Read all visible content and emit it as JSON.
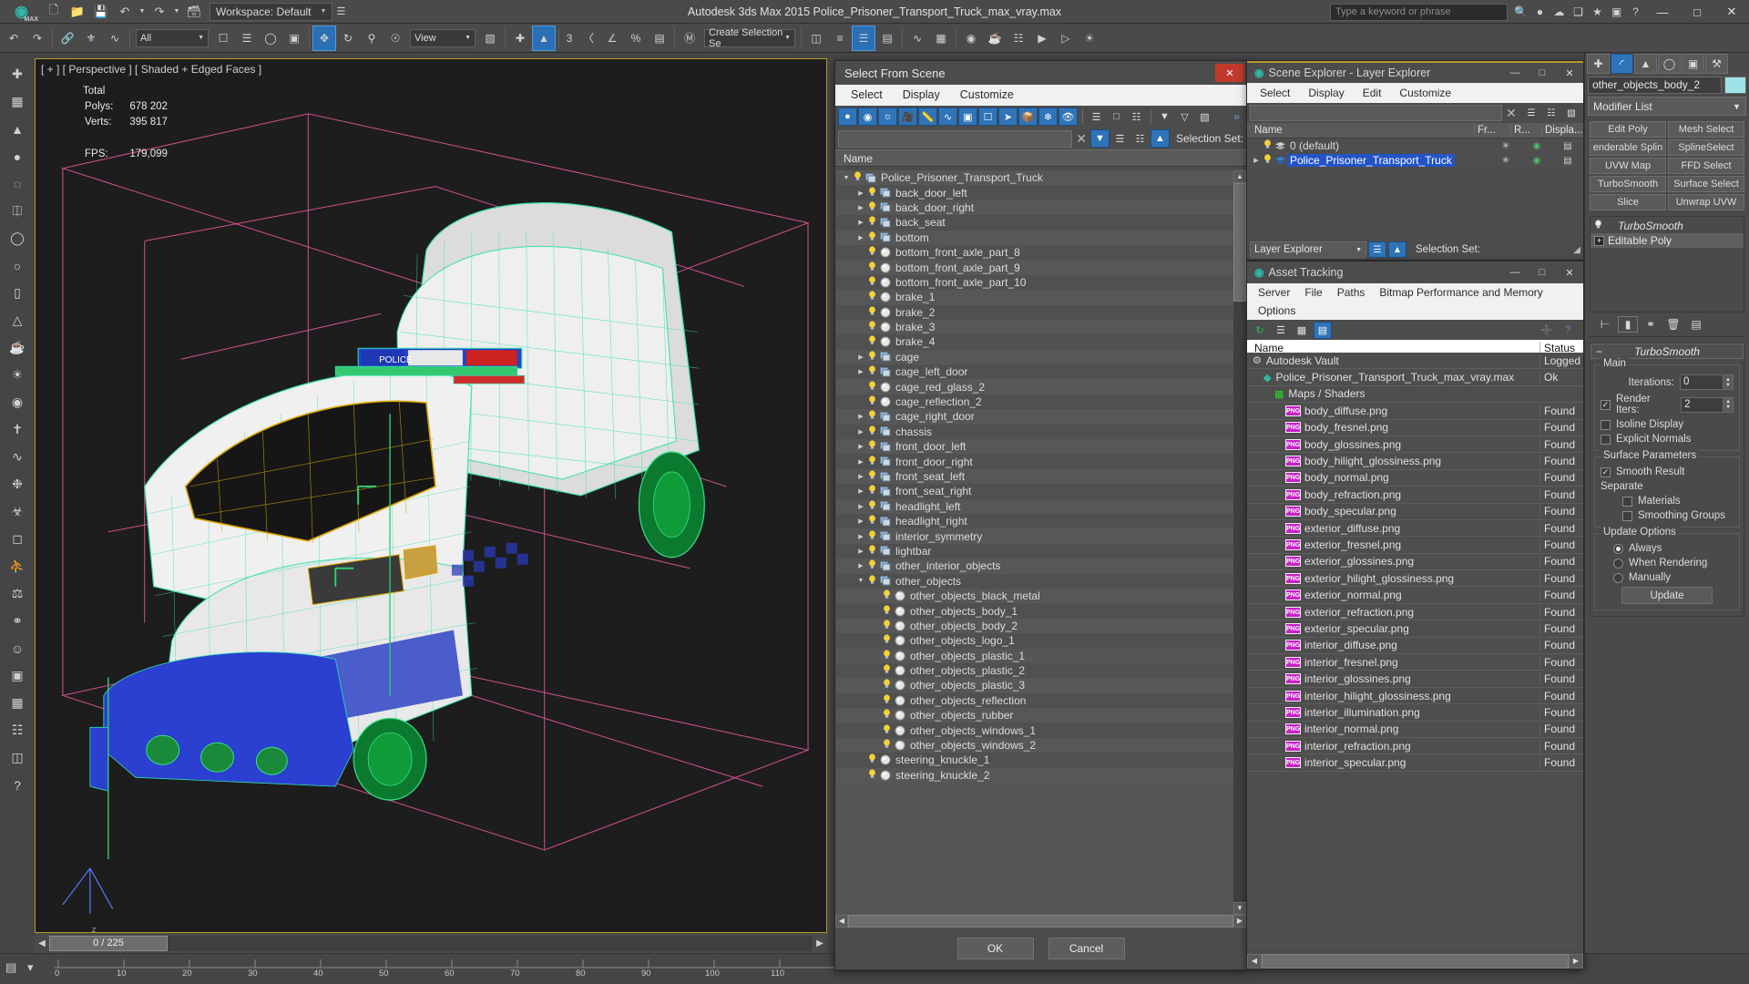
{
  "titlebar": {
    "app_title": "Autodesk 3ds Max  2015     Police_Prisoner_Transport_Truck_max_vray.max",
    "workspace": "Workspace: Default",
    "search_placeholder": "Type a keyword or phrase",
    "quick_icons": [
      "new-icon",
      "open-icon",
      "save-icon",
      "undo-icon",
      "redo-icon",
      "set-project-icon"
    ],
    "window_buttons": [
      "minimize",
      "maximize",
      "close"
    ]
  },
  "toolbar": {
    "selection_filter": "All",
    "reference_coord": "View",
    "named_set": "Create Selection Se",
    "snap_number": "3"
  },
  "viewport": {
    "label": "[ + ] [ Perspective ] [ Shaded + Edged Faces ]",
    "stats_title": "Total",
    "stats": [
      {
        "label": "Polys:",
        "value": "678 202"
      },
      {
        "label": "Verts:",
        "value": "395 817"
      },
      {
        "label": "FPS:",
        "value": "179,099"
      }
    ]
  },
  "timeline": {
    "current_frame": "0 / 225",
    "ticks": [
      "0",
      "10",
      "20",
      "30",
      "40",
      "50",
      "60",
      "70",
      "80",
      "90",
      "100",
      "110"
    ]
  },
  "select_from_scene": {
    "title": "Select From Scene",
    "menu": [
      "Select",
      "Display",
      "Customize"
    ],
    "search_value": "",
    "selection_set_label": "Selection Set:",
    "column_header": "Name",
    "ok_label": "OK",
    "cancel_label": "Cancel",
    "tree": [
      {
        "name": "Police_Prisoner_Transport_Truck",
        "depth": 0,
        "expander": "down",
        "icon": "group"
      },
      {
        "name": "back_door_left",
        "depth": 1,
        "expander": "right",
        "icon": "group"
      },
      {
        "name": "back_door_right",
        "depth": 1,
        "expander": "right",
        "icon": "group"
      },
      {
        "name": "back_seat",
        "depth": 1,
        "expander": "right",
        "icon": "group"
      },
      {
        "name": "bottom",
        "depth": 1,
        "expander": "right",
        "icon": "group"
      },
      {
        "name": "bottom_front_axle_part_8",
        "depth": 1,
        "expander": "none",
        "icon": "mesh"
      },
      {
        "name": "bottom_front_axle_part_9",
        "depth": 1,
        "expander": "none",
        "icon": "mesh"
      },
      {
        "name": "bottom_front_axle_part_10",
        "depth": 1,
        "expander": "none",
        "icon": "mesh"
      },
      {
        "name": "brake_1",
        "depth": 1,
        "expander": "none",
        "icon": "mesh"
      },
      {
        "name": "brake_2",
        "depth": 1,
        "expander": "none",
        "icon": "mesh"
      },
      {
        "name": "brake_3",
        "depth": 1,
        "expander": "none",
        "icon": "mesh"
      },
      {
        "name": "brake_4",
        "depth": 1,
        "expander": "none",
        "icon": "mesh"
      },
      {
        "name": "cage",
        "depth": 1,
        "expander": "right",
        "icon": "group"
      },
      {
        "name": "cage_left_door",
        "depth": 1,
        "expander": "right",
        "icon": "group"
      },
      {
        "name": "cage_red_glass_2",
        "depth": 1,
        "expander": "none",
        "icon": "mesh"
      },
      {
        "name": "cage_reflection_2",
        "depth": 1,
        "expander": "none",
        "icon": "mesh"
      },
      {
        "name": "cage_right_door",
        "depth": 1,
        "expander": "right",
        "icon": "group"
      },
      {
        "name": "chassis",
        "depth": 1,
        "expander": "right",
        "icon": "group"
      },
      {
        "name": "front_door_left",
        "depth": 1,
        "expander": "right",
        "icon": "group"
      },
      {
        "name": "front_door_right",
        "depth": 1,
        "expander": "right",
        "icon": "group"
      },
      {
        "name": "front_seat_left",
        "depth": 1,
        "expander": "right",
        "icon": "group"
      },
      {
        "name": "front_seat_right",
        "depth": 1,
        "expander": "right",
        "icon": "group"
      },
      {
        "name": "headlight_left",
        "depth": 1,
        "expander": "right",
        "icon": "group"
      },
      {
        "name": "headlight_right",
        "depth": 1,
        "expander": "right",
        "icon": "group"
      },
      {
        "name": "interior_symmetry",
        "depth": 1,
        "expander": "right",
        "icon": "group"
      },
      {
        "name": "lightbar",
        "depth": 1,
        "expander": "right",
        "icon": "group"
      },
      {
        "name": "other_interior_objects",
        "depth": 1,
        "expander": "right",
        "icon": "group"
      },
      {
        "name": "other_objects",
        "depth": 1,
        "expander": "down",
        "icon": "group"
      },
      {
        "name": "other_objects_black_metal",
        "depth": 2,
        "expander": "none",
        "icon": "mesh"
      },
      {
        "name": "other_objects_body_1",
        "depth": 2,
        "expander": "none",
        "icon": "mesh"
      },
      {
        "name": "other_objects_body_2",
        "depth": 2,
        "expander": "none",
        "icon": "mesh"
      },
      {
        "name": "other_objects_logo_1",
        "depth": 2,
        "expander": "none",
        "icon": "mesh"
      },
      {
        "name": "other_objects_plastic_1",
        "depth": 2,
        "expander": "none",
        "icon": "mesh"
      },
      {
        "name": "other_objects_plastic_2",
        "depth": 2,
        "expander": "none",
        "icon": "mesh"
      },
      {
        "name": "other_objects_plastic_3",
        "depth": 2,
        "expander": "none",
        "icon": "mesh"
      },
      {
        "name": "other_objects_reflection",
        "depth": 2,
        "expander": "none",
        "icon": "mesh"
      },
      {
        "name": "other_objects_rubber",
        "depth": 2,
        "expander": "none",
        "icon": "mesh"
      },
      {
        "name": "other_objects_windows_1",
        "depth": 2,
        "expander": "none",
        "icon": "mesh"
      },
      {
        "name": "other_objects_windows_2",
        "depth": 2,
        "expander": "none",
        "icon": "mesh"
      },
      {
        "name": "steering_knuckle_1",
        "depth": 1,
        "expander": "none",
        "icon": "mesh"
      },
      {
        "name": "steering_knuckle_2",
        "depth": 1,
        "expander": "none",
        "icon": "mesh"
      }
    ]
  },
  "scene_explorer": {
    "title": "Scene Explorer - Layer Explorer",
    "menu": [
      "Select",
      "Display",
      "Edit",
      "Customize"
    ],
    "columns": [
      "Name",
      "Fr...",
      "R...",
      "Displa..."
    ],
    "rows": [
      {
        "name": "0 (default)",
        "selected": false,
        "expander": "none"
      },
      {
        "name": "Police_Prisoner_Transport_Truck",
        "selected": true,
        "expander": "right"
      }
    ],
    "footer_combo": "Layer Explorer",
    "selection_set_label": "Selection Set:"
  },
  "asset_tracking": {
    "title": "Asset Tracking",
    "menu_row1": [
      "Server",
      "File",
      "Paths",
      "Bitmap Performance and Memory"
    ],
    "menu_row2": [
      "Options"
    ],
    "columns": [
      "Name",
      "Status"
    ],
    "rows": [
      {
        "name": "Autodesk Vault",
        "status": "Logged",
        "icon": "vault",
        "depth": 0
      },
      {
        "name": "Police_Prisoner_Transport_Truck_max_vray.max",
        "status": "Ok",
        "icon": "max",
        "depth": 1
      },
      {
        "name": "Maps / Shaders",
        "status": "",
        "icon": "maps",
        "depth": 2
      },
      {
        "name": "body_diffuse.png",
        "status": "Found",
        "icon": "png",
        "depth": 3
      },
      {
        "name": "body_fresnel.png",
        "status": "Found",
        "icon": "png",
        "depth": 3
      },
      {
        "name": "body_glossines.png",
        "status": "Found",
        "icon": "png",
        "depth": 3
      },
      {
        "name": "body_hilight_glossiness.png",
        "status": "Found",
        "icon": "png",
        "depth": 3
      },
      {
        "name": "body_normal.png",
        "status": "Found",
        "icon": "png",
        "depth": 3
      },
      {
        "name": "body_refraction.png",
        "status": "Found",
        "icon": "png",
        "depth": 3
      },
      {
        "name": "body_specular.png",
        "status": "Found",
        "icon": "png",
        "depth": 3
      },
      {
        "name": "exterior_diffuse.png",
        "status": "Found",
        "icon": "png",
        "depth": 3
      },
      {
        "name": "exterior_fresnel.png",
        "status": "Found",
        "icon": "png",
        "depth": 3
      },
      {
        "name": "exterior_glossines.png",
        "status": "Found",
        "icon": "png",
        "depth": 3
      },
      {
        "name": "exterior_hilight_glossiness.png",
        "status": "Found",
        "icon": "png",
        "depth": 3
      },
      {
        "name": "exterior_normal.png",
        "status": "Found",
        "icon": "png",
        "depth": 3
      },
      {
        "name": "exterior_refraction.png",
        "status": "Found",
        "icon": "png",
        "depth": 3
      },
      {
        "name": "exterior_specular.png",
        "status": "Found",
        "icon": "png",
        "depth": 3
      },
      {
        "name": "interior_diffuse.png",
        "status": "Found",
        "icon": "png",
        "depth": 3
      },
      {
        "name": "interior_fresnel.png",
        "status": "Found",
        "icon": "png",
        "depth": 3
      },
      {
        "name": "interior_glossines.png",
        "status": "Found",
        "icon": "png",
        "depth": 3
      },
      {
        "name": "interior_hilight_glossiness.png",
        "status": "Found",
        "icon": "png",
        "depth": 3
      },
      {
        "name": "interior_illumination.png",
        "status": "Found",
        "icon": "png",
        "depth": 3
      },
      {
        "name": "interior_normal.png",
        "status": "Found",
        "icon": "png",
        "depth": 3
      },
      {
        "name": "interior_refraction.png",
        "status": "Found",
        "icon": "png",
        "depth": 3
      },
      {
        "name": "interior_specular.png",
        "status": "Found",
        "icon": "png",
        "depth": 3
      }
    ]
  },
  "command_panel": {
    "object_name": "other_objects_body_2",
    "object_color": "#9fe3e8",
    "modifier_list_label": "Modifier List",
    "modifier_buttons": [
      "Edit Poly",
      "Mesh Select",
      "enderable Splin",
      "SplineSelect",
      "UVW Map",
      "FFD Select",
      "TurboSmooth",
      "Surface Select",
      "Slice",
      "Unwrap UVW"
    ],
    "stack": [
      {
        "name": "TurboSmooth",
        "italic": true,
        "selected": false
      },
      {
        "name": "Editable Poly",
        "italic": false,
        "selected": true
      }
    ],
    "rollup": {
      "title": "TurboSmooth",
      "main_group": "Main",
      "iterations_label": "Iterations:",
      "iterations_value": "0",
      "render_iters_label": "Render Iters:",
      "render_iters_value": "2",
      "render_iters_checked": true,
      "isoline_label": "Isoline Display",
      "isoline_checked": false,
      "explicit_normals_label": "Explicit Normals",
      "explicit_normals_checked": false,
      "surface_group": "Surface Parameters",
      "smooth_result_label": "Smooth Result",
      "smooth_result_checked": true,
      "separate_label": "Separate",
      "materials_label": "Materials",
      "materials_checked": false,
      "smoothing_groups_label": "Smoothing Groups",
      "smoothing_groups_checked": false,
      "update_group": "Update Options",
      "update_options": [
        {
          "label": "Always",
          "selected": true
        },
        {
          "label": "When Rendering",
          "selected": false
        },
        {
          "label": "Manually",
          "selected": false
        }
      ],
      "update_button": "Update"
    }
  }
}
